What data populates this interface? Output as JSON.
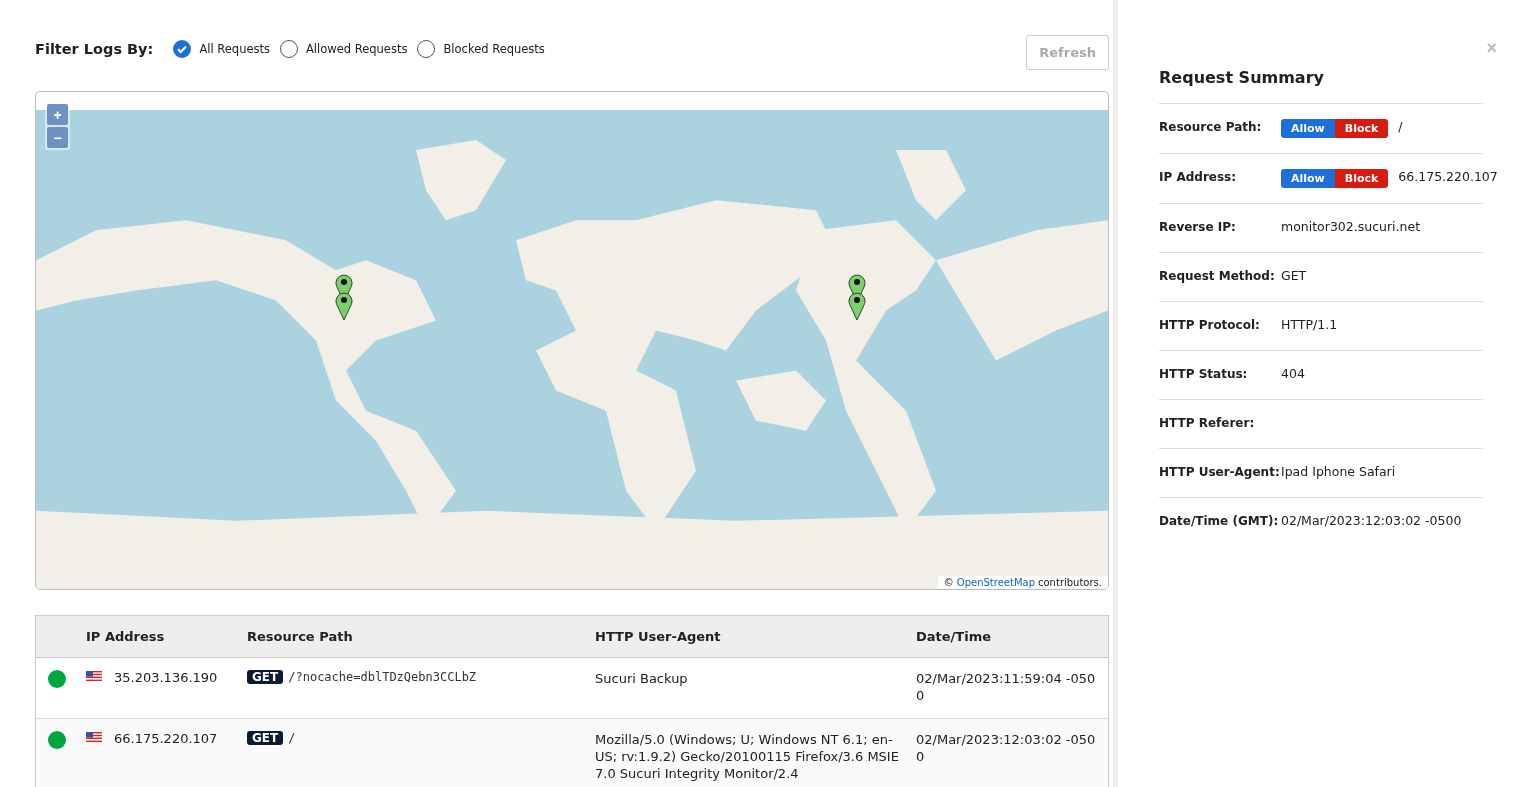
{
  "filter": {
    "label": "Filter Logs By:",
    "options": [
      {
        "label": "All Requests",
        "selected": true
      },
      {
        "label": "Allowed Requests",
        "selected": false
      },
      {
        "label": "Blocked Requests",
        "selected": false
      }
    ]
  },
  "refresh_button": "Refresh",
  "map": {
    "zoom_in": "+",
    "zoom_out": "−",
    "attribution_prefix": "©",
    "attribution_link": "OpenStreetMap",
    "attribution_suffix": "contributors."
  },
  "table": {
    "columns": [
      "IP Address",
      "Resource Path",
      "HTTP User-Agent",
      "Date/Time"
    ],
    "rows": [
      {
        "color": "#00a63f",
        "ip": "35.203.136.190",
        "method": "GET",
        "path": "/?nocache=dblTDzQebn3CCLbZ",
        "user_agent": "Sucuri Backup",
        "datetime": "02/Mar/2023:11:59:04 -0500"
      },
      {
        "color": "#00a63f",
        "ip": "66.175.220.107",
        "method": "GET",
        "path": "/",
        "user_agent": "Mozilla/5.0 (Windows; U; Windows NT 6.1; en-US; rv:1.9.2) Gecko/20100115 Firefox/3.6 MSIE 7.0 Sucuri Integrity Monitor/2.4",
        "datetime": "02/Mar/2023:12:03:02 -0500"
      }
    ]
  },
  "summary": {
    "close": "×",
    "title": "Request Summary",
    "fields": [
      {
        "kind": "action",
        "label": "Resource Path:",
        "allow": "Allow",
        "block": "Block",
        "value": "/"
      },
      {
        "kind": "action",
        "label": "IP Address:",
        "allow": "Allow",
        "block": "Block",
        "value": "66.175.220.107"
      },
      {
        "kind": "text",
        "label": "Reverse IP:",
        "value": "monitor302.sucuri.net"
      },
      {
        "kind": "text",
        "label": "Request Method:",
        "value": "GET"
      },
      {
        "kind": "text",
        "label": "HTTP Protocol:",
        "value": "HTTP/1.1"
      },
      {
        "kind": "text",
        "label": "HTTP Status:",
        "value": "404"
      },
      {
        "kind": "text",
        "label": "HTTP Referer:"
      },
      {
        "kind": "text",
        "label": "HTTP User-Agent:",
        "value": "Ipad Iphone Safari"
      },
      {
        "kind": "text",
        "label": "Date/Time (GMT):",
        "value": "02/Mar/2023:12:03:02 -0500"
      }
    ]
  }
}
